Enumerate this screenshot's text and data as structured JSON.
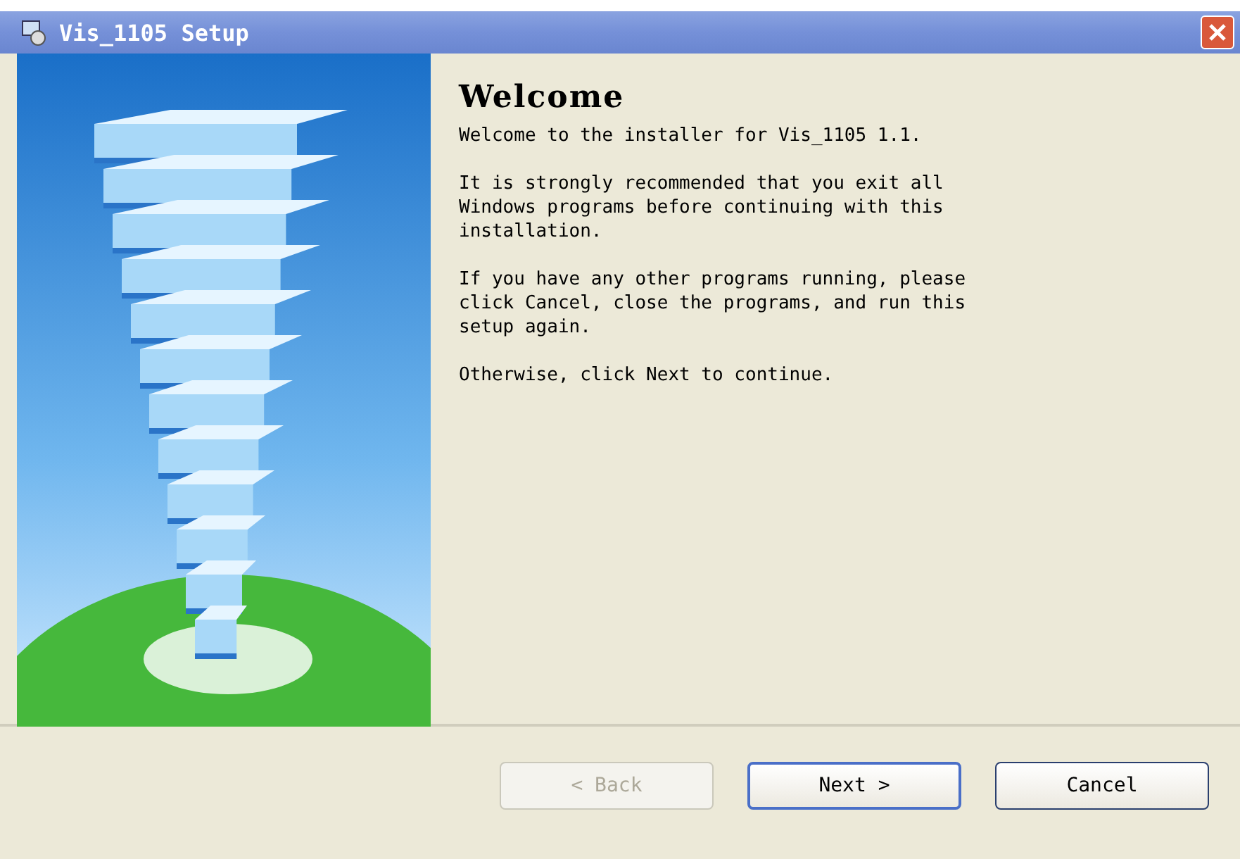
{
  "window": {
    "title": "Vis_1105 Setup"
  },
  "heading": "Welcome",
  "paragraphs": [
    "Welcome to the installer for Vis_1105 1.1.",
    "It is strongly recommended that you exit all Windows programs before continuing with this installation.",
    "If you have any other programs running, please click Cancel, close the programs, and run this setup again.",
    "Otherwise, click Next to continue."
  ],
  "buttons": [
    {
      "label": "< Back",
      "disabled": true,
      "default": false
    },
    {
      "label": "Next >",
      "disabled": false,
      "default": true
    },
    {
      "label": "Cancel",
      "disabled": false,
      "default": false
    }
  ]
}
